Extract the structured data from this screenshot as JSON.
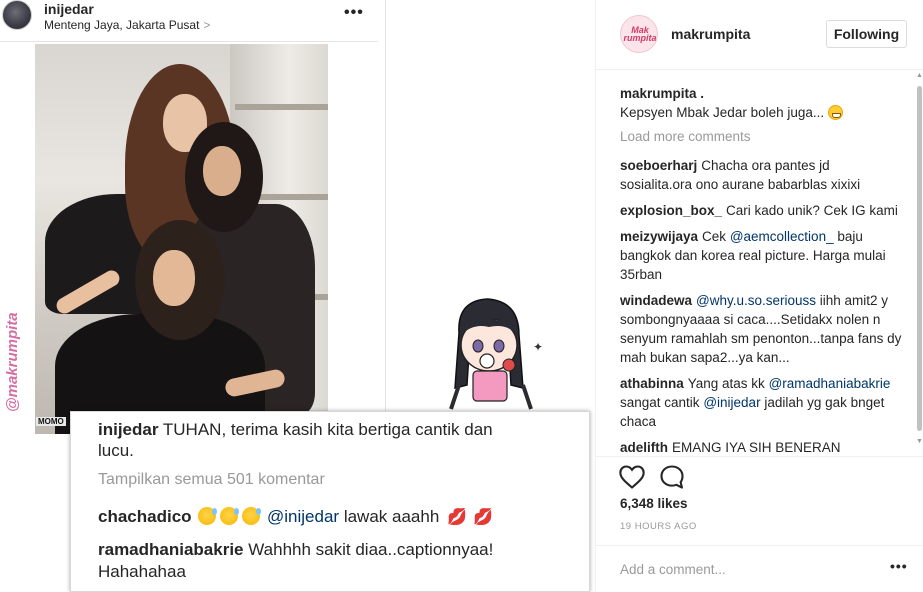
{
  "inner_post": {
    "username": "inijedar",
    "location": "Menteng Jaya, Jakarta Pusat",
    "location_chevron": ">",
    "more_label": "•••",
    "watermark": "@makrumpita",
    "photo_credit": "MOMO"
  },
  "caption_card": {
    "caption_user": "inijedar",
    "caption_text_line1": "TUHAN, terima kasih kita bertiga cantik dan",
    "caption_text_line2": "lucu.",
    "view_all": "Tampilkan semua 501 komentar",
    "comments": [
      {
        "user": "chachadico",
        "mention": "@inijedar",
        "text": "lawak aaahh"
      },
      {
        "user": "ramadhaniabakrie",
        "text_line1": "Wahhhh sakit diaa..captionnyaa!",
        "text_line2": "Hahahahaa"
      }
    ]
  },
  "sidebar": {
    "avatar_text_line1": "Mak",
    "avatar_text_line2": "rumpita",
    "username": "makrumpita",
    "follow_label": "Following",
    "caption": {
      "user": "makrumpita .",
      "text": "Kepsyen Mbak Jedar boleh juga..."
    },
    "load_more": "Load more comments",
    "comments": [
      {
        "user": "soeboerharj",
        "text": "Chacha ora pantes jd sosialita.ora ono aurane babarblas xixixi"
      },
      {
        "user": "explosion_box_",
        "text": "Cari kado unik? Cek IG kami"
      },
      {
        "user": "meizywijaya",
        "text_before": "Cek",
        "mention": "@aemcollection_",
        "text": "baju bangkok dan korea real picture. Harga mulai 35rban"
      },
      {
        "user": "windadewa",
        "mention": "@why.u.so.seriouss",
        "text": "iihh amit2 y sombongnyaaaa si caca....Setidakx nolen n senyum ramahlah sm penonton...tanpa fans dy mah bukan sapa2...ya kan..."
      },
      {
        "user": "athabinna",
        "text_before": "Yang atas kk",
        "mention": "@ramadhaniabakrie",
        "text": "sangat cantik",
        "mention2": "@inijedar",
        "text2": "jadilah yg gak bnget chaca"
      },
      {
        "user": "adelifth",
        "text": "EMANG IYA SIH BENERAN"
      }
    ],
    "likes": "6,348 likes",
    "timestamp": "19 HOURS AGO",
    "add_comment_placeholder": "Add a comment...",
    "more_label": "•••"
  },
  "colors": {
    "text": "#262626",
    "muted": "#999999",
    "mention": "#003569",
    "border": "#efefef",
    "watermark": "#d46da3"
  }
}
